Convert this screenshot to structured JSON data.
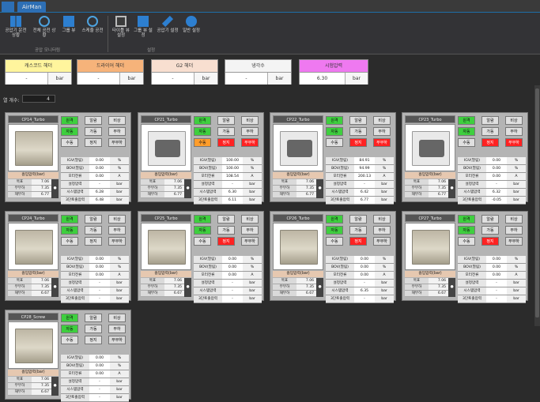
{
  "app": {
    "tab": "AirMan"
  },
  "ribbon": {
    "buttons": [
      "공압기 운전상황",
      "전체 공전 상황",
      "그룹 뷰",
      "스케쥴 공전",
      "타이틀 뷰 설정",
      "그룹 뷰 설정",
      "공압기 설정",
      "일반 설정"
    ],
    "group1": "공압 모니터링",
    "group2": "설정"
  },
  "headers": [
    {
      "title": "캐스코드 헤더",
      "value": "-",
      "unit": "bar",
      "color": "#fff59d"
    },
    {
      "title": "드라이어 헤더",
      "value": "-",
      "unit": "bar",
      "color": "#f6b37a"
    },
    {
      "title": "G2 헤더",
      "value": "-",
      "unit": "bar",
      "color": "#f8dfd0"
    },
    {
      "title": "냉각수",
      "value": "-",
      "unit": "bar",
      "color": "#f4f4f4"
    },
    {
      "title": "시험압력",
      "value": "6.30",
      "unit": "bar",
      "color": "#ef79f0"
    }
  ],
  "count": {
    "label": "열 개수:",
    "value": "4"
  },
  "status": {
    "on": "원격",
    "off": "알람",
    "stop": "비상",
    "auto": "자동",
    "load": "가동",
    "unload": "부하",
    "manual": "수동",
    "stopx": "정지",
    "noload": "무부하"
  },
  "param_labels": [
    "IGV(열림)",
    "BOV(열림)",
    "모터전류",
    "설정압력",
    "시스템압력",
    "3단토출압력"
  ],
  "units": [
    "%",
    "%",
    "A",
    "bar",
    "bar",
    "bar"
  ],
  "left_labels": [
    "흡입압력(bar)",
    "목표",
    "무부하",
    "재부하"
  ],
  "cards": [
    {
      "name": "CP14_Turbo",
      "mach": "dark",
      "vals": [
        "0.00",
        "0.00",
        "0.00",
        "-",
        "6.28",
        "6.48"
      ],
      "lv": [
        "7.06",
        "7.35",
        "6.77"
      ],
      "ss": [
        "#e0e0e0",
        "#e0e0e0",
        "#d9d9d9"
      ]
    },
    {
      "name": "CP21_Turbo",
      "mach": "open",
      "vals": [
        "100.00",
        "100.00",
        "108.54",
        "-",
        "6.30",
        "6.11"
      ],
      "lv": [
        "7.06",
        "7.35",
        "6.77"
      ],
      "ss": [
        "#ff9d2b",
        "#ff2222",
        "#ff2222"
      ]
    },
    {
      "name": "CP22_Turbo",
      "mach": "open",
      "vals": [
        "84.91",
        "94.99",
        "200.13",
        "-",
        "6.42",
        "6.77"
      ],
      "lv": [
        "7.06",
        "7.35",
        "6.77"
      ],
      "ss": [
        "#e0e0e0",
        "#ff2222",
        "#ff2222"
      ]
    },
    {
      "name": "CP23_Turbo",
      "mach": "open",
      "vals": [
        "0.00",
        "0.00",
        "0.00",
        "-",
        "6.32",
        "-0.05"
      ],
      "lv": [
        "7.06",
        "7.35",
        "6.77"
      ],
      "ss": [
        "#e0e0e0",
        "#ff2222",
        "#ff2222"
      ]
    },
    {
      "name": "CP24_Turbo",
      "mach": "dark",
      "vals": [
        "0.00",
        "0.00",
        "0.00",
        "-",
        "-",
        "-"
      ],
      "lv": [
        "7.06",
        "7.35",
        "6.67"
      ],
      "ss": [
        "#e0e0e0",
        "#e0e0e0",
        "#d9d9d9"
      ]
    },
    {
      "name": "CP25_Turbo",
      "mach": "dark",
      "vals": [
        "0.00",
        "0.00",
        "0.00",
        "-",
        "-",
        "-"
      ],
      "lv": [
        "7.06",
        "7.35",
        "6.67"
      ],
      "ss": [
        "#e0e0e0",
        "#ff2222",
        "#d9d9d9"
      ]
    },
    {
      "name": "CP26_Turbo",
      "mach": "dark",
      "vals": [
        "0.00",
        "0.00",
        "0.00",
        "-",
        "6.35",
        "-"
      ],
      "lv": [
        "7.06",
        "7.35",
        "6.67"
      ],
      "ss": [
        "#e0e0e0",
        "#ff2222",
        "#d9d9d9"
      ]
    },
    {
      "name": "CP27_Turbo",
      "mach": "dark",
      "vals": [
        "0.00",
        "0.00",
        "0.00",
        "-",
        "-",
        "-"
      ],
      "lv": [
        "7.06",
        "7.35",
        "6.67"
      ],
      "ss": [
        "#e0e0e0",
        "#ff2222",
        "#d9d9d9"
      ]
    },
    {
      "name": "CP28_Screw",
      "mach": "dark",
      "vals": [
        "0.00",
        "0.00",
        "0.00",
        "-",
        "-",
        "-"
      ],
      "lv": [
        "7.06",
        "7.35",
        "6.67"
      ],
      "ss": [
        "#e0e0e0",
        "#e0e0e0",
        "#d9d9d9"
      ]
    }
  ]
}
